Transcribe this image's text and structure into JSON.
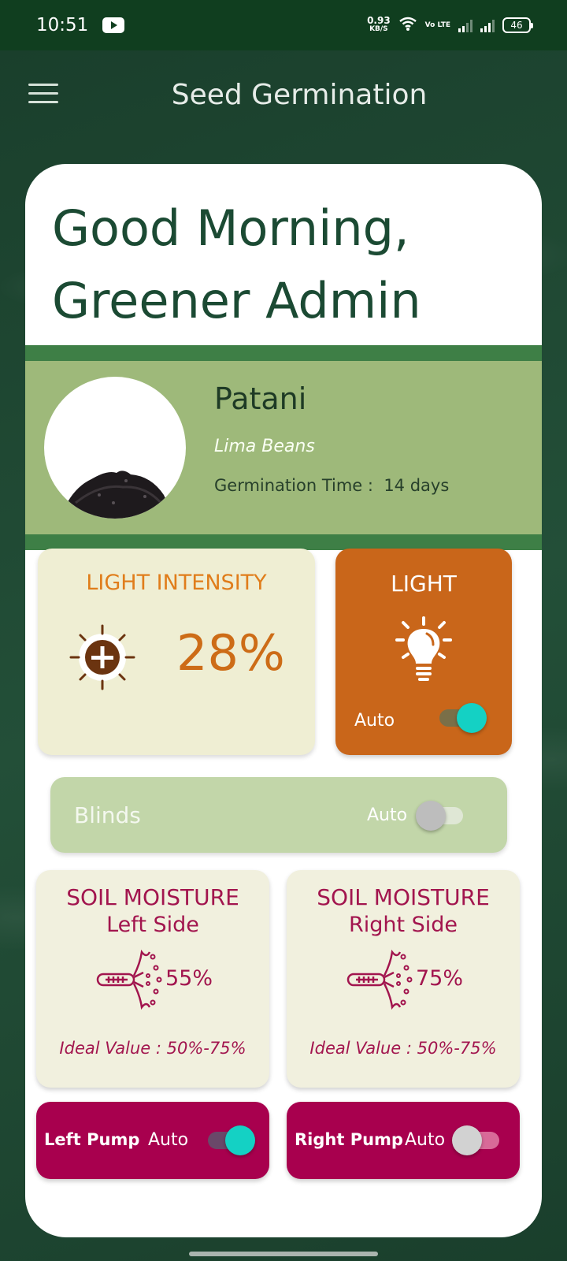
{
  "status_bar": {
    "time": "10:51",
    "speed_value": "0.93",
    "speed_unit": "KB/S",
    "volte": "Vo LTE",
    "battery": "46"
  },
  "app_bar": {
    "title": "Seed Germination"
  },
  "greeting": "Good Morning, Greener Admin",
  "plant": {
    "name": "Patani",
    "scientific_name": "Lima Beans",
    "germination_time": "Germination Time :  14 days"
  },
  "light_intensity": {
    "title": "LIGHT INTENSITY",
    "value": "28%"
  },
  "light": {
    "title": "LIGHT",
    "auto_label": "Auto",
    "auto_on": true
  },
  "blinds": {
    "label": "Blinds",
    "auto_label": "Auto",
    "auto_on": false
  },
  "soil_left": {
    "title": "SOIL MOISTURE",
    "subtitle": "Left Side",
    "value": "55%",
    "ideal": "Ideal Value : 50%-75%"
  },
  "soil_right": {
    "title": "SOIL MOISTURE",
    "subtitle": "Right Side",
    "value": "75%",
    "ideal": "Ideal Value : 50%-75%"
  },
  "left_pump": {
    "label": "Left Pump",
    "auto_label": "Auto",
    "auto_on": true
  },
  "right_pump": {
    "label": "Right Pump",
    "auto_label": "Auto",
    "auto_on": false
  },
  "colors": {
    "accent_teal": "#14d1c4",
    "soil_magenta": "#a2154e",
    "light_orange": "#c9661a",
    "brand_green": "#1b4a33"
  }
}
